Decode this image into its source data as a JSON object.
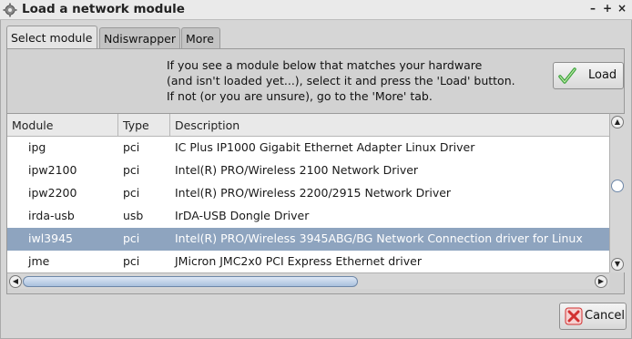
{
  "window": {
    "title": "Load a network module",
    "minimize": "–",
    "maximize": "+",
    "close": "×"
  },
  "tabs": [
    "Select module",
    "Ndiswrapper",
    "More"
  ],
  "info": {
    "line1": "If you see a module below that matches your hardware",
    "line2": "(and isn't loaded yet...), select it and press the 'Load' button.",
    "line3": "If not (or you are unsure), go to the 'More' tab."
  },
  "load_button": "Load",
  "table": {
    "columns": [
      "Module",
      "Type",
      "Description"
    ],
    "rows": [
      {
        "module": "ipg",
        "type": "pci",
        "description": "IC Plus IP1000 Gigabit Ethernet Adapter Linux Driver"
      },
      {
        "module": "ipw2100",
        "type": "pci",
        "description": "Intel(R) PRO/Wireless 2100 Network Driver"
      },
      {
        "module": "ipw2200",
        "type": "pci",
        "description": "Intel(R) PRO/Wireless 2200/2915 Network Driver"
      },
      {
        "module": "irda-usb",
        "type": "usb",
        "description": "IrDA-USB Dongle Driver"
      },
      {
        "module": "iwl3945",
        "type": "pci",
        "description": "Intel(R) PRO/Wireless 3945ABG/BG Network Connection driver for Linux"
      },
      {
        "module": "jme",
        "type": "pci",
        "description": "JMicron JMC2x0 PCI Express Ethernet driver"
      }
    ],
    "selected_row": 4
  },
  "cancel_button": "Cancel",
  "icons": {
    "title": "gear-icon",
    "load": "checkmark-icon",
    "cancel": "cross-icon"
  },
  "colors": {
    "selection": "#8ea4bf",
    "load_check": "#3aa33a",
    "cancel_x": "#d23030"
  }
}
